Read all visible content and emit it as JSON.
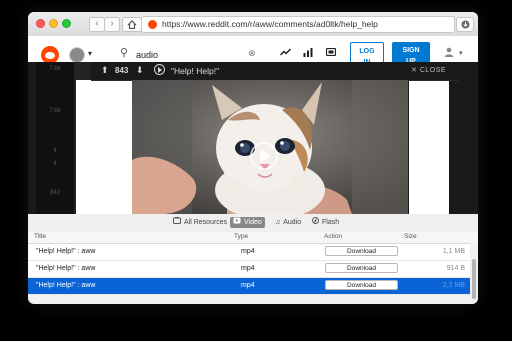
{
  "browser": {
    "url": "https://www.reddit.com/r/aww/comments/ad0ltk/help_help",
    "back_glyph": "‹",
    "fwd_glyph": "›"
  },
  "reddit_header": {
    "search_value": "audio",
    "login_line1": "LOG",
    "login_line2": "IN",
    "signup_line1": "SIGN",
    "signup_line2": "UP"
  },
  "sidebar": {
    "votes": [
      "7.6k",
      "7.6k",
      "4",
      "4",
      "843"
    ]
  },
  "post": {
    "score": "843",
    "title": "\"Help! Help!\"",
    "close_label": "CLOSE"
  },
  "filters": [
    {
      "label": "All Resources",
      "active": false
    },
    {
      "label": "Video",
      "active": true
    },
    {
      "label": "Audio",
      "active": false
    },
    {
      "label": "Flash",
      "active": false
    }
  ],
  "table": {
    "headers": {
      "title": "Title",
      "type": "Type",
      "action": "Action",
      "size": "Size"
    },
    "rows": [
      {
        "title": "\"Help! Help!\" : aww",
        "type": "mp4",
        "action": "Download",
        "size": "1,1 MB",
        "selected": false
      },
      {
        "title": "\"Help! Help!\" : aww",
        "type": "mp4",
        "action": "Download",
        "size": "914 B",
        "selected": false
      },
      {
        "title": "\"Help! Help!\" : aww",
        "type": "mp4",
        "action": "Download",
        "size": "2,2 MB",
        "selected": true
      }
    ]
  },
  "colors": {
    "reddit_orange": "#ff4500",
    "reddit_blue": "#0079d3",
    "selection_blue": "#0a64d6"
  }
}
